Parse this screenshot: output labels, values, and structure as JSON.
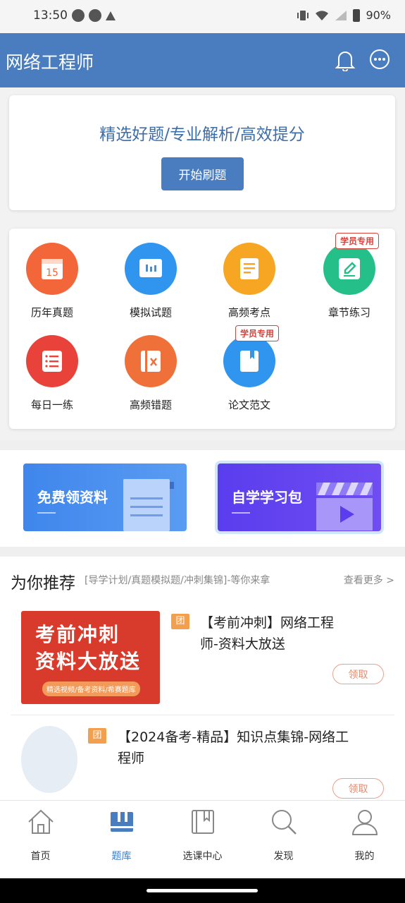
{
  "status": {
    "time": "13:50",
    "battery": "90%"
  },
  "header": {
    "title": "网络工程师"
  },
  "hero": {
    "slogan": "精选好题/专业解析/高效提分",
    "button": "开始刷题"
  },
  "grid": {
    "badge_text": "学员专用",
    "items": [
      {
        "label": "历年真题",
        "color": "#f2663a",
        "icon": "calendar-icon"
      },
      {
        "label": "模拟试题",
        "color": "#2f95ef",
        "icon": "presentation-icon"
      },
      {
        "label": "高频考点",
        "color": "#f6a623",
        "icon": "document-icon"
      },
      {
        "label": "章节练习",
        "color": "#25c08a",
        "icon": "edit-icon"
      },
      {
        "label": "每日一练",
        "color": "#e8423a",
        "icon": "list-icon"
      },
      {
        "label": "高频错题",
        "color": "#f0703a",
        "icon": "error-book-icon"
      },
      {
        "label": "论文范文",
        "color": "#2f95ef",
        "icon": "bookmark-icon"
      }
    ]
  },
  "banners": {
    "left": "免费领资料",
    "right": "自学学习包"
  },
  "recommend": {
    "title": "为你推荐",
    "subtitle": "[导学计划/真题模拟题/冲刺集锦]-等你来拿",
    "more": "查看更多 >",
    "tuan": "团",
    "claim": "领取",
    "item1": {
      "title_line1": "【考前冲刺】网络工程",
      "title_line2": "师-资料大放送",
      "thumb_line1": "考前冲刺",
      "thumb_line2": "资料大放送",
      "thumb_tag": "精选视频/备考资料/希赛题库"
    },
    "item2": {
      "title_line1": "【2024备考-精品】知识点集锦-网络工",
      "title_line2": "程师"
    }
  },
  "nav": [
    {
      "label": "首页",
      "icon": "home-icon"
    },
    {
      "label": "题库",
      "icon": "question-bank-icon"
    },
    {
      "label": "选课中心",
      "icon": "course-center-icon"
    },
    {
      "label": "发现",
      "icon": "search-icon"
    },
    {
      "label": "我的",
      "icon": "profile-icon"
    }
  ]
}
